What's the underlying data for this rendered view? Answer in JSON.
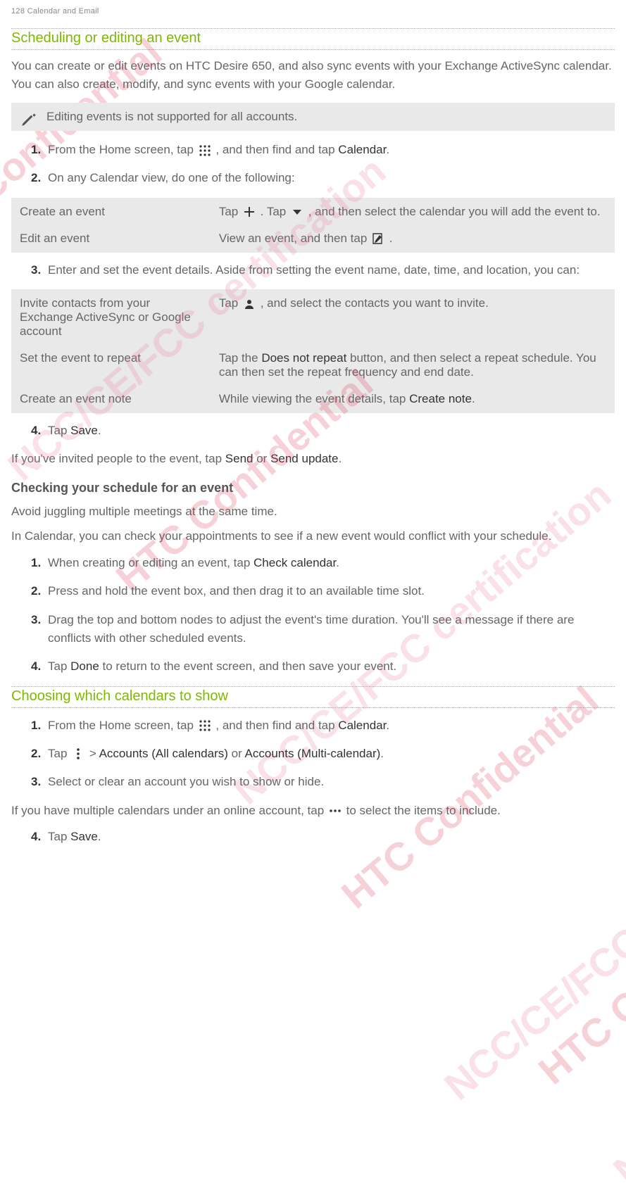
{
  "page_header": "128    Calendar and Email",
  "section1": {
    "title": "Scheduling or editing an event",
    "intro": "You can create or edit events on HTC Desire 650, and also sync events with your Exchange ActiveSync calendar. You can also create, modify, and sync events with your Google calendar.",
    "note": "Editing events is not supported for all accounts.",
    "step1_a": "From the Home screen, tap ",
    "step1_b": ", and then find and tap ",
    "step1_c": "Calendar",
    "step1_d": ".",
    "step2": "On any Calendar view, do one of the following:",
    "table1": {
      "row1_label": "Create an event",
      "row1_a": "Tap ",
      "row1_b": ". Tap ",
      "row1_c": ", and then select the calendar you will add the event to.",
      "row2_label": "Edit an event",
      "row2_a": "View an event, and then tap ",
      "row2_b": "."
    },
    "step3": "Enter and set the event details. Aside from setting the event name, date, time, and location, you can:",
    "table2": {
      "row1_label": " Invite contacts from your Exchange ActiveSync or Google account",
      "row1_a": " Tap ",
      "row1_b": ", and select the contacts you want to invite.",
      "row2_label": "Set the event to repeat",
      "row2_a": "Tap the ",
      "row2_b": "Does not repeat",
      "row2_c": " button, and then select a repeat schedule. You can then set the repeat frequency and end date.",
      "row3_label": "Create an event note",
      "row3_a": "While viewing the event details, tap ",
      "row3_b": "Create note",
      "row3_c": "."
    },
    "step4_a": "Tap ",
    "step4_b": "Save",
    "step4_c": ".",
    "after_steps_a": "If you've invited people to the event, tap ",
    "after_steps_b": "Send",
    "after_steps_c": " or ",
    "after_steps_d": "Send update",
    "after_steps_e": ".",
    "subheading": "Checking your schedule for an event",
    "sub_intro": "Avoid juggling multiple meetings at the same time.",
    "sub_para": "In Calendar, you can check your appointments to see if a new event would conflict with your schedule.",
    "sub_steps": {
      "s1_a": "When creating or editing an event, tap ",
      "s1_b": "Check calendar",
      "s1_c": ".",
      "s2": "Press and hold the event box, and then drag it to an available time slot.",
      "s3": "Drag the top and bottom nodes to adjust the event's time duration. You'll see a message if there are conflicts with other scheduled events.",
      "s4_a": "Tap ",
      "s4_b": "Done",
      "s4_c": " to return to the event screen, and then save your event."
    }
  },
  "section2": {
    "title": "Choosing which calendars to show",
    "step1_a": "From the Home screen, tap ",
    "step1_b": ", and then find and tap ",
    "step1_c": "Calendar",
    "step1_d": ".",
    "step2_a": "Tap ",
    "step2_b": " > ",
    "step2_c": "Accounts (All calendars)",
    "step2_d": " or ",
    "step2_e": "Accounts (Multi-calendar)",
    "step2_f": ".",
    "step3": "Select or clear an account you wish to show or hide.",
    "after_a": "If you have multiple calendars under an online account, tap ",
    "after_b": " to select the items to include.",
    "step4_a": "Tap ",
    "step4_b": "Save",
    "step4_c": "."
  },
  "watermarks": {
    "w1": "HTC Confidential",
    "w2": "NCC/CE/FCC certification",
    "w3": "HTC Confidential",
    "w4": "NCC/CE/FCC certification",
    "w5": "HTC Confidential",
    "w6": "NCC/CE/FCC certification",
    "w7": "HTC Confidential",
    "w8": "NCC/CE/FCC certification"
  }
}
